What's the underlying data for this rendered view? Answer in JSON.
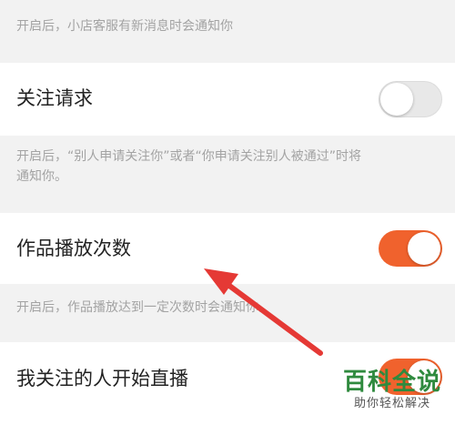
{
  "notes": {
    "shop_service": "开启后，小店客服有新消息时会通知你",
    "follow_request_line1": "开启后，“别人申请关注你”或者“你申请关注别人被通过”时将",
    "follow_request_line2": "通知你。",
    "play_count": "开启后，作品播放达到一定次数时会通知你。"
  },
  "settings": [
    {
      "label": "关注请求",
      "enabled": false
    },
    {
      "label": "作品播放次数",
      "enabled": true
    },
    {
      "label": "我关注的人开始直播",
      "enabled": true
    }
  ],
  "watermark": {
    "title": "百科全说",
    "subtitle": "助你轻松解决"
  },
  "colors": {
    "toggle_on": "#f0622d",
    "toggle_off": "#e8e8e8",
    "arrow": "#e53935",
    "watermark": "#2f8a3e"
  }
}
